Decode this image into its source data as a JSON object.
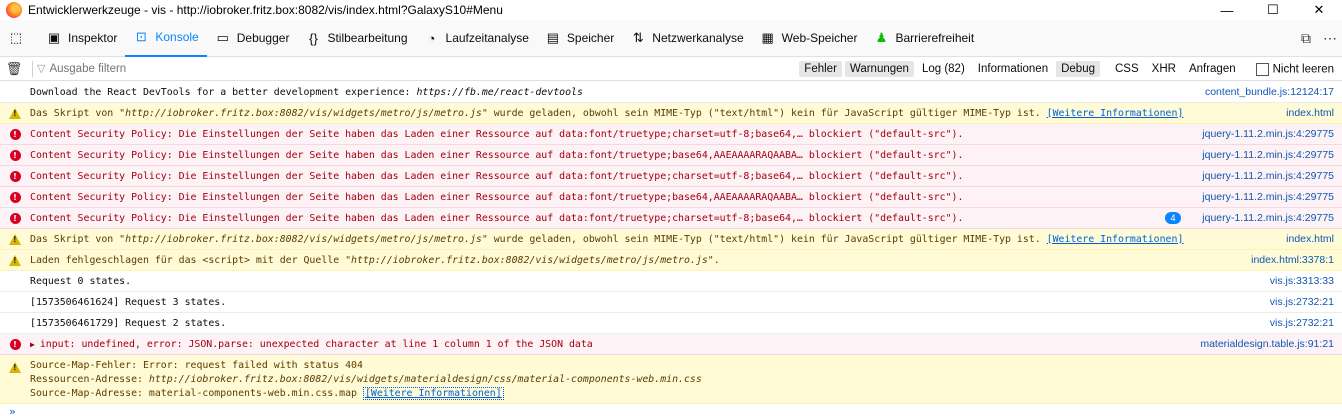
{
  "window": {
    "title": "Entwicklerwerkzeuge - vis - http://iobroker.fritz.box:8082/vis/index.html?GalaxyS10#Menu",
    "minimize": "—",
    "maximize": "☐",
    "close": "✕"
  },
  "toolbar": {
    "tabs": [
      {
        "label": "Inspektor",
        "icon": "inspector-icon"
      },
      {
        "label": "Konsole",
        "icon": "console-icon",
        "active": true
      },
      {
        "label": "Debugger",
        "icon": "debugger-icon"
      },
      {
        "label": "Stilbearbeitung",
        "icon": "style-editor-icon"
      },
      {
        "label": "Laufzeitanalyse",
        "icon": "performance-icon"
      },
      {
        "label": "Speicher",
        "icon": "memory-icon"
      },
      {
        "label": "Netzwerkanalyse",
        "icon": "network-icon"
      },
      {
        "label": "Web-Speicher",
        "icon": "storage-icon"
      },
      {
        "label": "Barrierefreiheit",
        "icon": "accessibility-icon"
      }
    ]
  },
  "filterbar": {
    "placeholder": "Ausgabe filtern",
    "levels": [
      "Fehler",
      "Warnungen",
      "Log (82)",
      "Informationen",
      "Debug"
    ],
    "types": [
      "CSS",
      "XHR",
      "Anfragen"
    ],
    "persist_label": "Nicht leeren"
  },
  "messages": {
    "m0": {
      "text": "Download the React DevTools for a better development experience: ",
      "text_italic": "https://fb.me/react-devtools",
      "source": "content_bundle.js:12124:17"
    },
    "m1": {
      "text": "Das Skript von \"",
      "text_italic": "http://iobroker.fritz.box:8082/vis/widgets/metro/js/metro.js",
      "text_after": "\" wurde geladen, obwohl sein MIME-Typ (\"text/html\") kein für JavaScript gültiger MIME-Typ ist. ",
      "learn": "[Weitere Informationen]",
      "source": "index.html"
    },
    "m2": {
      "text": "Content Security Policy: Die Einstellungen der Seite haben das Laden einer Ressource auf data:font/truetype;charset=utf-8;base64,… blockiert (\"default-src\").",
      "source": "jquery-1.11.2.min.js:4:29775"
    },
    "m3": {
      "text": "Content Security Policy: Die Einstellungen der Seite haben das Laden einer Ressource auf data:font/truetype;base64,AAEAAAARAQAABA… blockiert (\"default-src\").",
      "source": "jquery-1.11.2.min.js:4:29775"
    },
    "m4": {
      "text": "Content Security Policy: Die Einstellungen der Seite haben das Laden einer Ressource auf data:font/truetype;charset=utf-8;base64,… blockiert (\"default-src\").",
      "source": "jquery-1.11.2.min.js:4:29775"
    },
    "m5": {
      "text": "Content Security Policy: Die Einstellungen der Seite haben das Laden einer Ressource auf data:font/truetype;base64,AAEAAAARAQAABA… blockiert (\"default-src\").",
      "source": "jquery-1.11.2.min.js:4:29775"
    },
    "m6": {
      "text": "Content Security Policy: Die Einstellungen der Seite haben das Laden einer Ressource auf data:font/truetype;charset=utf-8;base64,… blockiert (\"default-src\").",
      "source": "jquery-1.11.2.min.js:4:29775",
      "badge": "4"
    },
    "m7": {
      "text": "Das Skript von \"",
      "text_italic": "http://iobroker.fritz.box:8082/vis/widgets/metro/js/metro.js",
      "text_after": "\" wurde geladen, obwohl sein MIME-Typ (\"text/html\") kein für JavaScript gültiger MIME-Typ ist. ",
      "learn": "[Weitere Informationen]",
      "source": "index.html"
    },
    "m8": {
      "text": "Laden fehlgeschlagen für das <script> mit der Quelle \"",
      "text_italic": "http://iobroker.fritz.box:8082/vis/widgets/metro/js/metro.js",
      "text_after": "\".",
      "source": "index.html:3378:1"
    },
    "m9": {
      "text": "Request 0 states.",
      "source": "vis.js:3313:33"
    },
    "m10": {
      "text": "[1573506461624] Request 3 states.",
      "source": "vis.js:2732:21"
    },
    "m11": {
      "text": "[1573506461729] Request 2 states.",
      "source": "vis.js:2732:21"
    },
    "m12": {
      "text": "input: undefined, error: JSON.parse: unexpected character at line 1 column 1 of the JSON data",
      "source": "materialdesign.table.js:91:21"
    },
    "m13": {
      "line1": "Source-Map-Fehler: Error: request failed with status 404",
      "line2_label": "Ressourcen-Adresse: ",
      "line2_url": "http://iobroker.fritz.box:8082/vis/widgets/materialdesign/css/material-components-web.min.css",
      "line3_label": "Source-Map-Adresse: material-components-web.min.css.map ",
      "learn": "[Weitere Informationen]"
    }
  },
  "prompt": "»"
}
